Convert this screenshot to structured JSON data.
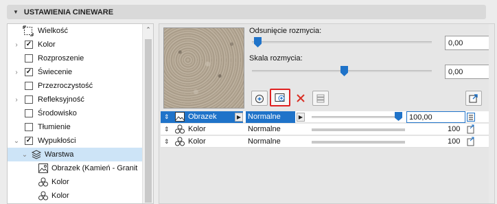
{
  "header": {
    "title": "USTAWIENIA CINEWARE"
  },
  "tree": {
    "items": [
      {
        "label": "Wielkość",
        "checkbox": null,
        "expander": false,
        "icon": "size-icon"
      },
      {
        "label": "Kolor",
        "checkbox": true,
        "expander": true
      },
      {
        "label": "Rozproszenie",
        "checkbox": false,
        "expander": false
      },
      {
        "label": "Świecenie",
        "checkbox": true,
        "expander": true
      },
      {
        "label": "Przezroczystość",
        "checkbox": false,
        "expander": false
      },
      {
        "label": "Refleksyjność",
        "checkbox": false,
        "expander": true
      },
      {
        "label": "Środowisko",
        "checkbox": false,
        "expander": false
      },
      {
        "label": "Tłumienie",
        "checkbox": false,
        "expander": false
      },
      {
        "label": "Wypukłości",
        "checkbox": true,
        "expander": "open"
      },
      {
        "label": "Warstwa",
        "icon": "layers-icon",
        "selected": true,
        "expander": "open"
      },
      {
        "label": "Obrazek (Kamień - Granit",
        "icon": "image-icon"
      },
      {
        "label": "Kolor",
        "icon": "color-circles-icon"
      },
      {
        "label": "Kolor",
        "icon": "color-circles-icon"
      }
    ]
  },
  "panel": {
    "blur_offset_label": "Odsunięcie rozmycia:",
    "blur_offset_value": "0,00",
    "blur_offset_level": 0.0,
    "blur_scale_label": "Skala rozmycia:",
    "blur_scale_value": "0,00",
    "blur_scale_level": 0.5
  },
  "layers": [
    {
      "name": "Obrazek",
      "mode": "Normalne",
      "value": "100,00",
      "opacity": 1.0,
      "selected": true,
      "icon": "image-icon"
    },
    {
      "name": "Kolor",
      "mode": "Normalne",
      "value": "100",
      "opacity": 1.0,
      "selected": false,
      "icon": "color-circles-icon"
    },
    {
      "name": "Kolor",
      "mode": "Normalne",
      "value": "100",
      "opacity": 1.0,
      "selected": false,
      "icon": "color-circles-icon"
    }
  ],
  "colors": {
    "accent": "#1f73c9",
    "highlight_border": "#e02020",
    "selection_bg": "#cde4f7"
  }
}
